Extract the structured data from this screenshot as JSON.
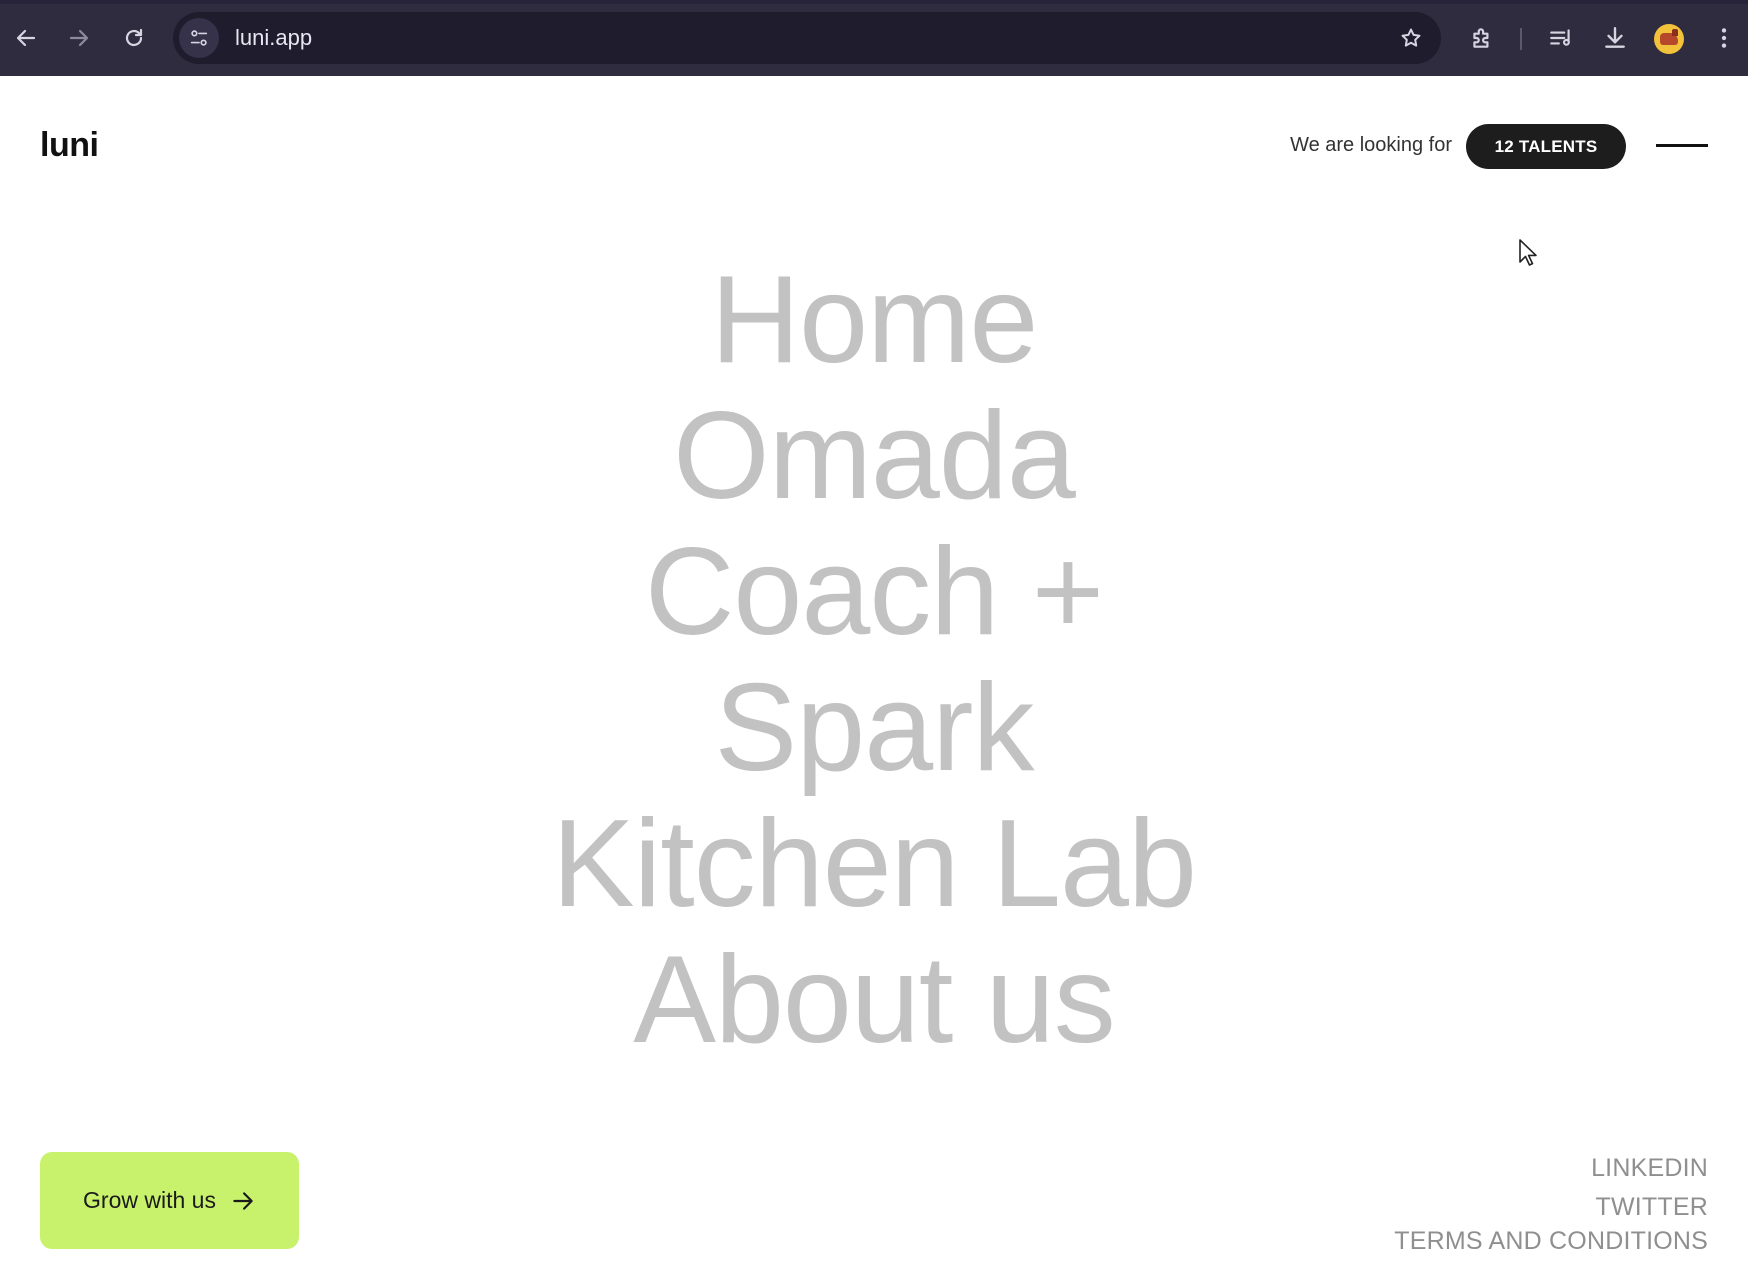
{
  "browser": {
    "url": "luni.app",
    "icons": [
      "back-arrow-icon",
      "forward-arrow-icon",
      "reload-icon",
      "site-info-icon",
      "star-icon",
      "extensions-icon",
      "media-queue-icon",
      "download-icon",
      "profile-avatar",
      "more-menu-icon"
    ]
  },
  "header": {
    "logo": "luni",
    "looking_for": "We are looking for",
    "talents_button": "12 TALENTS"
  },
  "nav": {
    "items": [
      {
        "label": "Home"
      },
      {
        "label": "Omada"
      },
      {
        "label": "Coach +"
      },
      {
        "label": "Spark"
      },
      {
        "label": "Kitchen Lab"
      },
      {
        "label": "About us"
      }
    ]
  },
  "cta": {
    "label": "Grow with us"
  },
  "footer": {
    "links": [
      "LINKEDIN",
      "TWITTER",
      "TERMS AND CONDITIONS"
    ]
  },
  "colors": {
    "chrome": "#2f2c3f",
    "address_bar": "#1f1c2d",
    "nav_text": "#c2c2c2",
    "cta_bg": "#c8f26b",
    "talents_bg": "#1d1d1d"
  }
}
